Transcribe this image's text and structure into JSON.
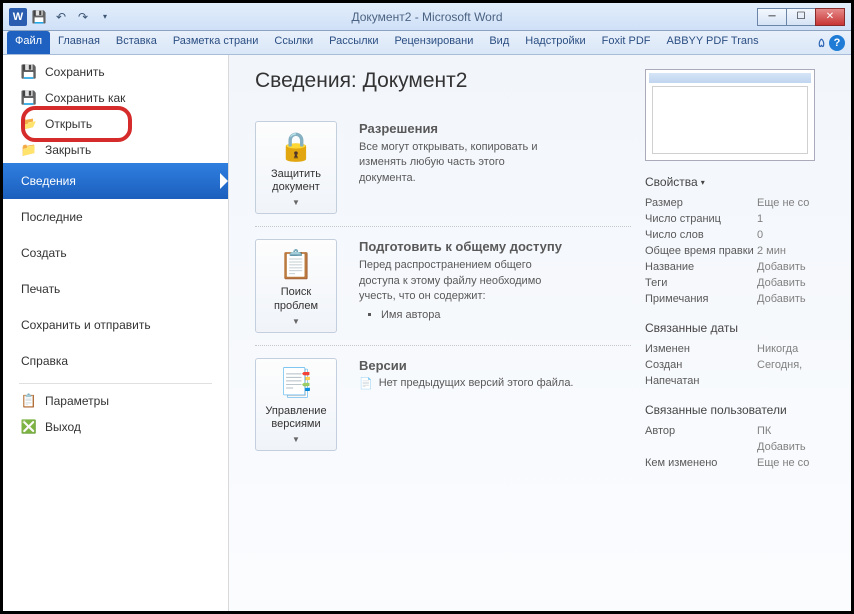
{
  "titlebar": {
    "title": "Документ2 - Microsoft Word",
    "wordIcon": "W"
  },
  "ribbon": {
    "tabs": [
      "Файл",
      "Главная",
      "Вставка",
      "Разметка страни",
      "Ссылки",
      "Рассылки",
      "Рецензировани",
      "Вид",
      "Надстройки",
      "Foxit PDF",
      "ABBYY PDF Trans"
    ]
  },
  "sidebar": {
    "items": [
      {
        "label": "Сохранить",
        "icon": "💾"
      },
      {
        "label": "Сохранить как",
        "icon": "💾"
      },
      {
        "label": "Открыть",
        "icon": "📂",
        "highlight": true
      },
      {
        "label": "Закрыть",
        "icon": "📁"
      }
    ],
    "bigItems": [
      "Сведения",
      "Последние",
      "Создать",
      "Печать",
      "Сохранить и отправить",
      "Справка"
    ],
    "footer": [
      {
        "label": "Параметры",
        "icon": "📋"
      },
      {
        "label": "Выход",
        "icon": "❎"
      }
    ],
    "selected": "Сведения"
  },
  "main": {
    "title": "Сведения: Документ2",
    "sections": [
      {
        "btnIcon": "🔒",
        "btnLabel": "Защитить документ",
        "heading": "Разрешения",
        "body": "Все могут открывать, копировать и изменять любую часть этого документа."
      },
      {
        "btnIcon": "📋",
        "btnLabel": "Поиск проблем",
        "heading": "Подготовить к общему доступу",
        "body": "Перед распространением общего доступа к этому файлу необходимо учесть, что он содержит:",
        "bullets": [
          "Имя автора"
        ]
      },
      {
        "btnIcon": "📑",
        "btnLabel": "Управление версиями",
        "heading": "Версии",
        "verIcon": "📄",
        "verText": "Нет предыдущих версий этого файла."
      }
    ]
  },
  "side": {
    "propsHead": "Свойства",
    "props": [
      {
        "k": "Размер",
        "v": "Еще не со"
      },
      {
        "k": "Число страниц",
        "v": "1"
      },
      {
        "k": "Число слов",
        "v": "0"
      },
      {
        "k": "Общее время правки",
        "v": "2 мин"
      },
      {
        "k": "Название",
        "v": "Добавить"
      },
      {
        "k": "Теги",
        "v": "Добавить"
      },
      {
        "k": "Примечания",
        "v": "Добавить"
      }
    ],
    "datesHead": "Связанные даты",
    "dates": [
      {
        "k": "Изменен",
        "v": "Никогда"
      },
      {
        "k": "Создан",
        "v": "Сегодня,"
      },
      {
        "k": "Напечатан",
        "v": ""
      }
    ],
    "usersHead": "Связанные пользователи",
    "users": [
      {
        "k": "Автор",
        "v": "ПК"
      },
      {
        "k": "",
        "v": "Добавить"
      },
      {
        "k": "Кем изменено",
        "v": "Еще не со"
      }
    ]
  }
}
